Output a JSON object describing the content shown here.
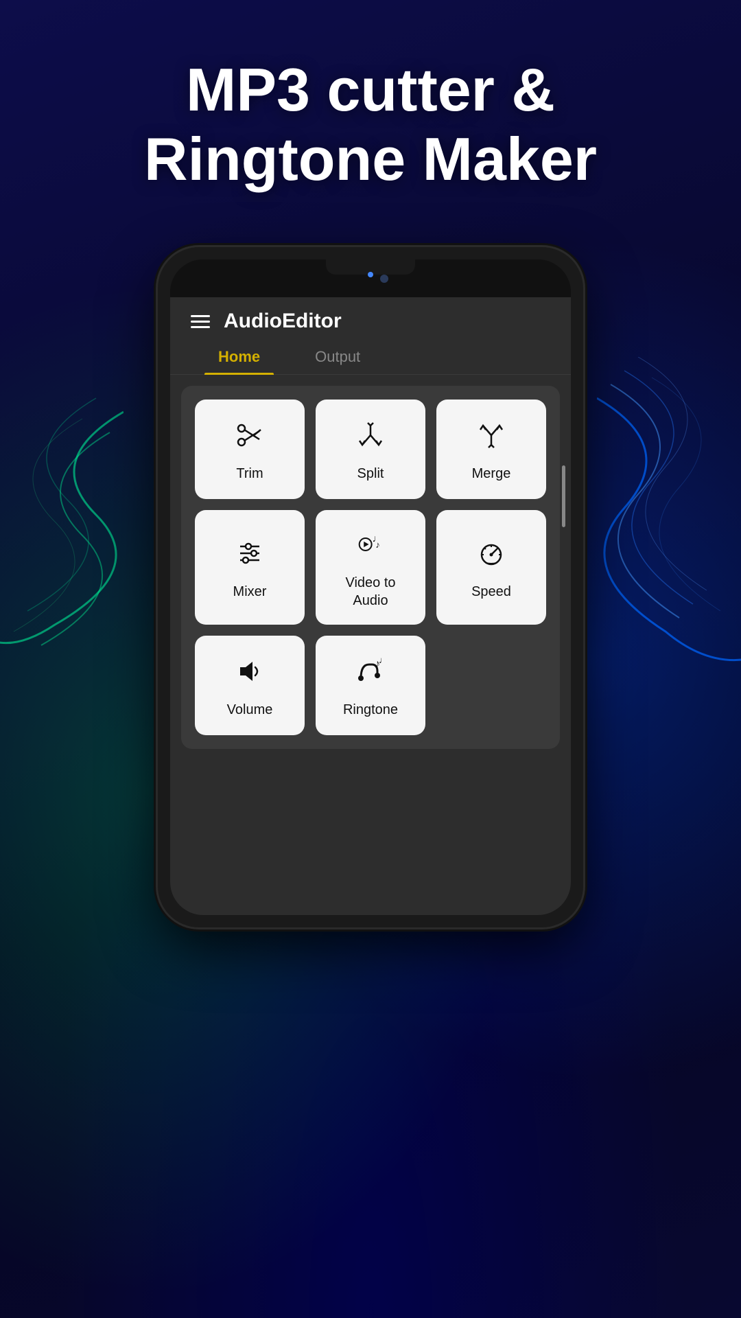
{
  "background": {
    "color": "#0a0a3a"
  },
  "title": {
    "line1": "MP3 cutter &",
    "line2": "Ringtone Maker"
  },
  "app": {
    "header": {
      "title": "AudioEditor",
      "menu_icon": "hamburger-menu"
    },
    "tabs": [
      {
        "id": "home",
        "label": "Home",
        "active": true
      },
      {
        "id": "output",
        "label": "Output",
        "active": false
      }
    ],
    "features": [
      {
        "id": "trim",
        "label": "Trim",
        "icon": "scissors"
      },
      {
        "id": "split",
        "label": "Split",
        "icon": "split-arrow"
      },
      {
        "id": "merge",
        "label": "Merge",
        "icon": "merge-arrow"
      },
      {
        "id": "mixer",
        "label": "Mixer",
        "icon": "sliders"
      },
      {
        "id": "video-to-audio",
        "label": "Video to\nAudio",
        "icon": "video-music"
      },
      {
        "id": "speed",
        "label": "Speed",
        "icon": "speedometer"
      },
      {
        "id": "volume",
        "label": "Volume",
        "icon": "volume"
      },
      {
        "id": "ringtone",
        "label": "Ringtone",
        "icon": "ringtone"
      }
    ],
    "colors": {
      "accent": "#d4b000",
      "background": "#2d2d2d",
      "card": "#f5f5f5",
      "text_primary": "#ffffff",
      "text_secondary": "#888888"
    }
  }
}
